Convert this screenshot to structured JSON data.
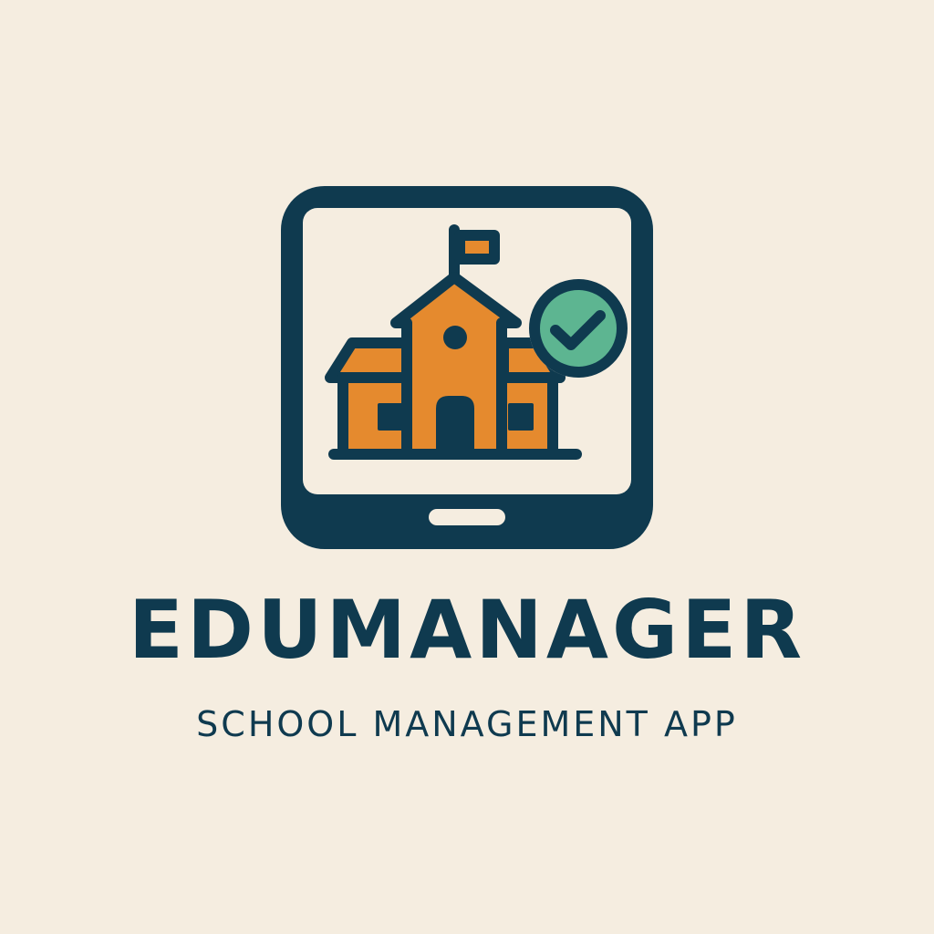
{
  "brand": {
    "name": "EDUMANAGER",
    "tagline": "SCHOOL MANAGEMENT APP"
  },
  "icons": {
    "device": "tablet-icon",
    "building": "school-building-icon",
    "badge": "checkmark-badge-icon",
    "flag": "flag-icon"
  },
  "colors": {
    "background": "#F5EDE0",
    "primary": "#0F3A4F",
    "accent": "#E58A2E",
    "success": "#5DB591"
  }
}
